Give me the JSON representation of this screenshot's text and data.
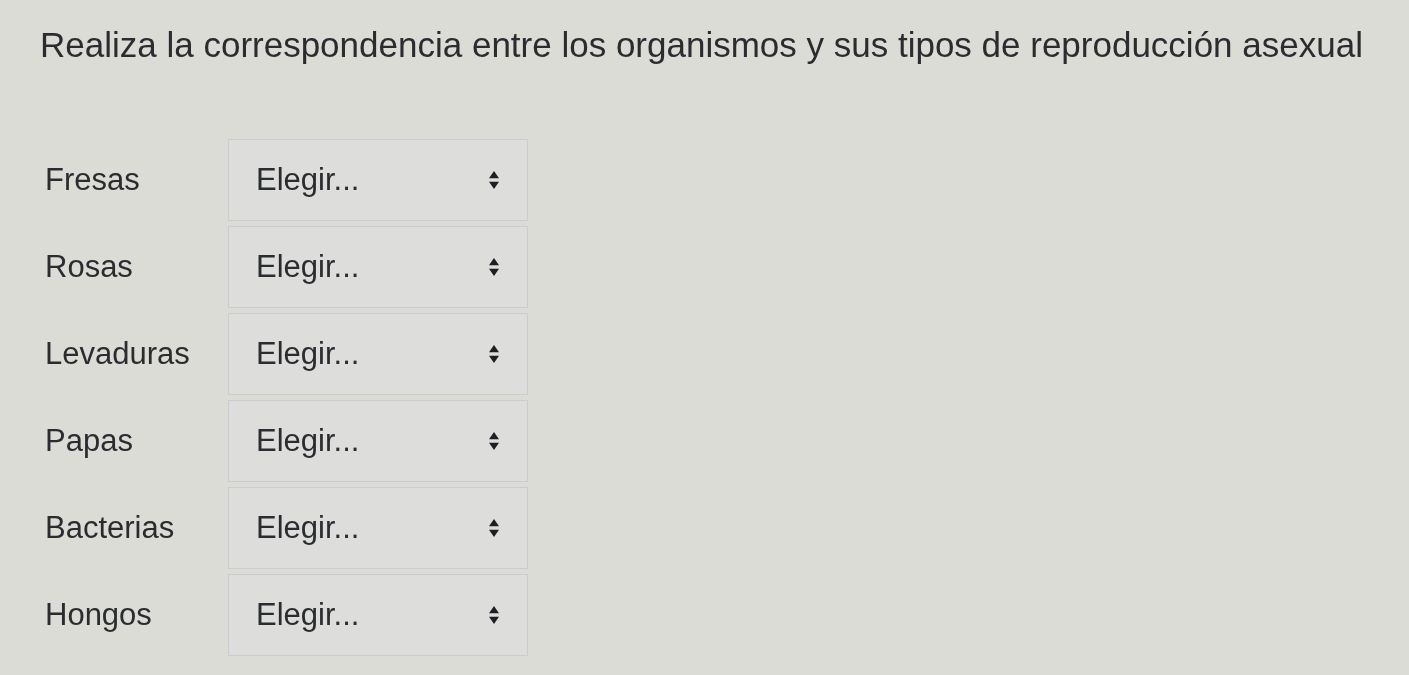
{
  "question": {
    "prompt": "Realiza la correspondencia entre los organismos y sus tipos de reproducción asexual"
  },
  "rows": [
    {
      "label": "Fresas",
      "select": {
        "value": "Elegir..."
      }
    },
    {
      "label": "Rosas",
      "select": {
        "value": "Elegir..."
      }
    },
    {
      "label": "Levaduras",
      "select": {
        "value": "Elegir..."
      }
    },
    {
      "label": "Papas",
      "select": {
        "value": "Elegir..."
      }
    },
    {
      "label": "Bacterias",
      "select": {
        "value": "Elegir..."
      }
    },
    {
      "label": "Hongos",
      "select": {
        "value": "Elegir..."
      }
    }
  ]
}
